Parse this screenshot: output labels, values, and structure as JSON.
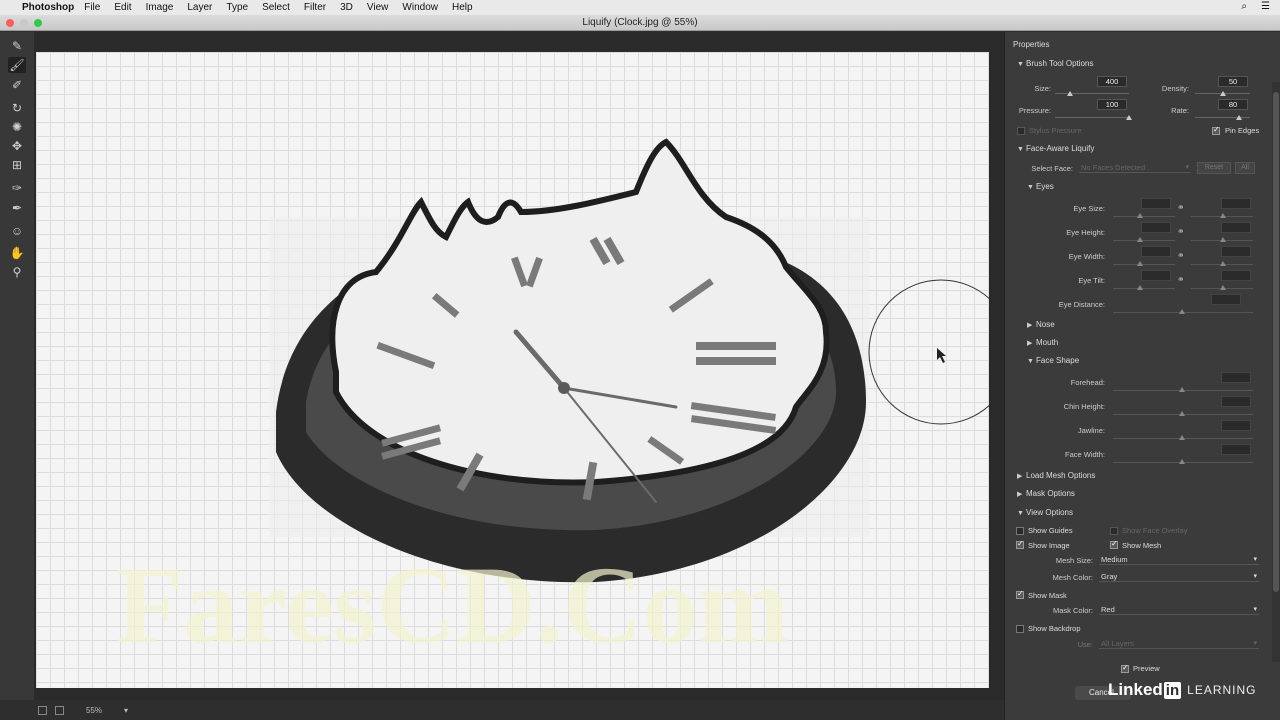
{
  "menubar": {
    "app_name": "Photoshop",
    "items": [
      "File",
      "Edit",
      "Image",
      "Layer",
      "Type",
      "Select",
      "Filter",
      "3D",
      "View",
      "Window",
      "Help"
    ]
  },
  "window": {
    "title": "Liquify (Clock.jpg @ 55%)"
  },
  "status": {
    "zoom": "55%"
  },
  "watermark": "FaresCD.Com",
  "properties": {
    "title": "Properties",
    "brush": {
      "title": "Brush Tool Options",
      "size_label": "Size:",
      "size": "400",
      "size_level": 0.2,
      "density_label": "Density:",
      "density": "50",
      "density_level": 0.5,
      "pressure_label": "Pressure:",
      "pressure": "100",
      "pressure_level": 1.0,
      "rate_label": "Rate:",
      "rate": "80",
      "rate_level": 0.8,
      "stylus_label": "Stylus Pressure",
      "pin_edges_label": "Pin Edges"
    },
    "face": {
      "title": "Face-Aware Liquify",
      "select_face_label": "Select Face:",
      "select_face_value": "No Faces Detected",
      "reset_label": "Reset",
      "all_label": "All",
      "eyes_title": "Eyes",
      "eye_size_label": "Eye Size:",
      "eye_height_label": "Eye Height:",
      "eye_width_label": "Eye Width:",
      "eye_tilt_label": "Eye Tilt:",
      "eye_distance_label": "Eye Distance:",
      "nose_title": "Nose",
      "mouth_title": "Mouth",
      "face_shape_title": "Face Shape",
      "forehead_label": "Forehead:",
      "chin_height_label": "Chin Height:",
      "jawline_label": "Jawline:",
      "face_width_label": "Face Width:"
    },
    "load_mesh_title": "Load Mesh Options",
    "mask_options_title": "Mask Options",
    "view": {
      "title": "View Options",
      "show_guides_label": "Show Guides",
      "show_face_overlay_label": "Show Face Overlay",
      "show_image_label": "Show Image",
      "show_mesh_label": "Show Mesh",
      "mesh_size_label": "Mesh Size:",
      "mesh_size_value": "Medium",
      "mesh_color_label": "Mesh Color:",
      "mesh_color_value": "Gray",
      "show_mask_label": "Show Mask",
      "mask_color_label": "Mask Color:",
      "mask_color_value": "Red",
      "show_backdrop_label": "Show Backdrop",
      "use_label": "Use:",
      "use_value": "All Layers"
    },
    "preview_label": "Preview"
  },
  "buttons": {
    "cancel": "Cancel"
  },
  "branding": {
    "linked": "Linked",
    "in": "in",
    "learning": "LEARNING"
  }
}
